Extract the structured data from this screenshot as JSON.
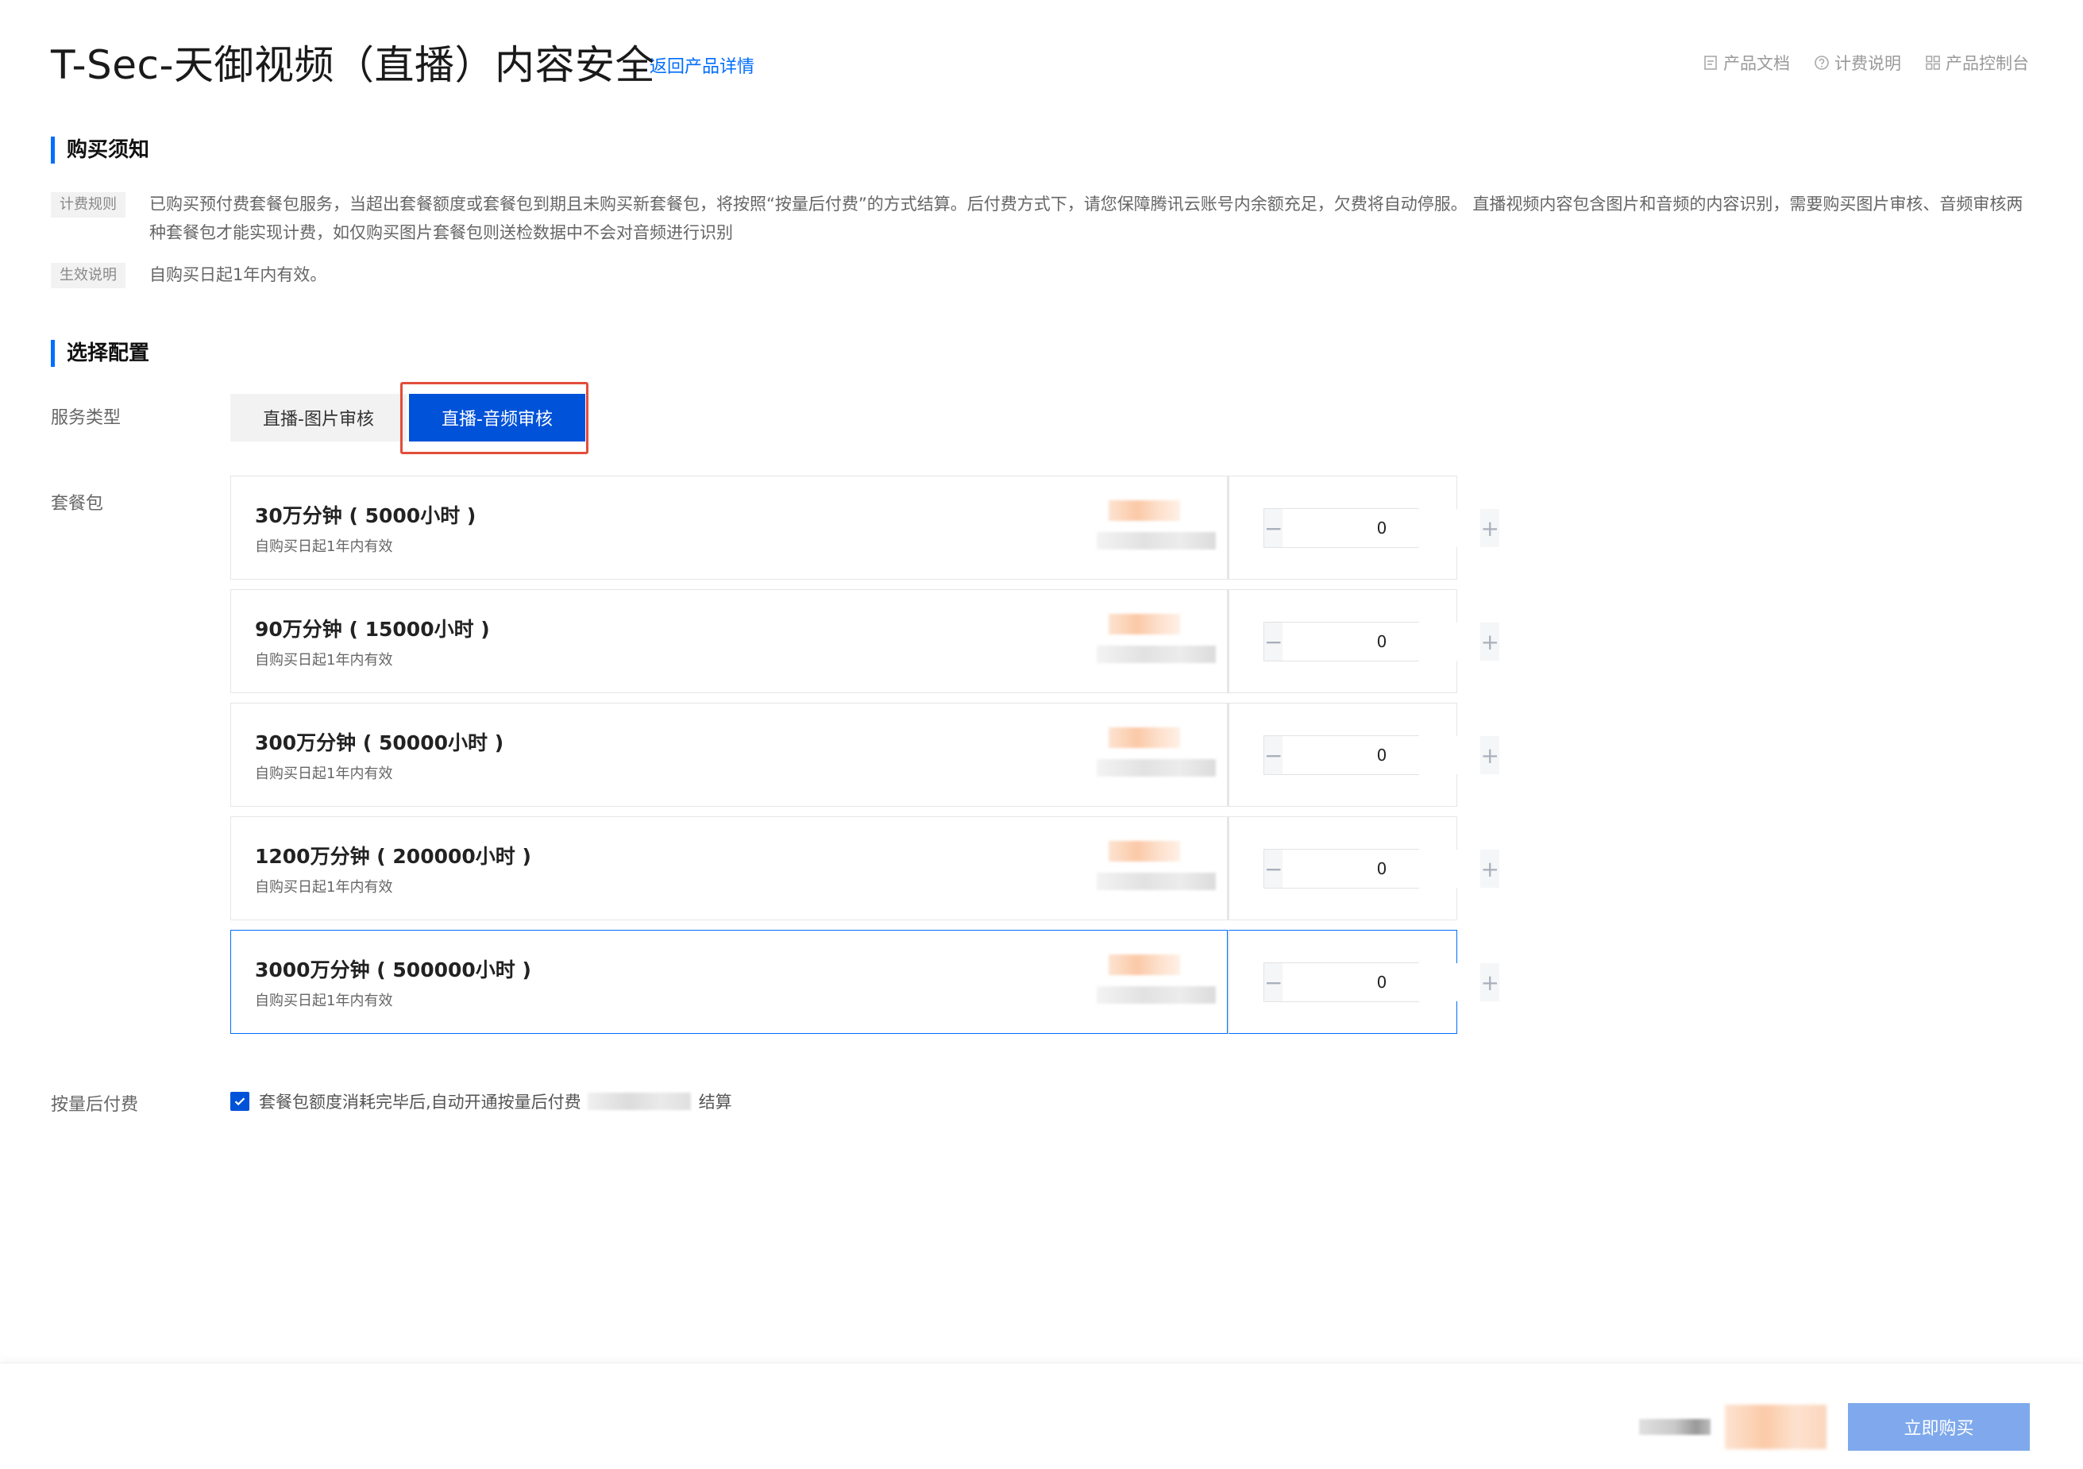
{
  "header": {
    "title": "T-Sec-天御视频（直播）内容安全",
    "back_link": "返回产品详情",
    "links": [
      {
        "label": "产品文档",
        "icon": "document-icon"
      },
      {
        "label": "计费说明",
        "icon": "question-circle-icon"
      },
      {
        "label": "产品控制台",
        "icon": "grid-icon"
      }
    ]
  },
  "notice": {
    "title": "购买须知",
    "rows": [
      {
        "tag": "计费规则",
        "text": "已购买预付费套餐包服务，当超出套餐额度或套餐包到期且未购买新套餐包，将按照“按量后付费”的方式结算。后付费方式下，请您保障腾讯云账号内余额充足，欠费将自动停服。 直播视频内容包含图片和音频的内容识别，需要购买图片审核、音频审核两种套餐包才能实现计费，如仅购买图片套餐包则送检数据中不会对音频进行识别"
      },
      {
        "tag": "生效说明",
        "text": "自购买日起1年内有效。"
      }
    ]
  },
  "config": {
    "title": "选择配置",
    "service_type_label": "服务类型",
    "service_types": [
      "直播-图片审核",
      "直播-音频审核"
    ],
    "selected_service_type": "直播-音频审核",
    "package_label": "套餐包",
    "packages": [
      {
        "name": "30万分钟 ( 5000小时 )",
        "desc": "自购买日起1年内有效",
        "qty": "0"
      },
      {
        "name": "90万分钟 ( 15000小时 )",
        "desc": "自购买日起1年内有效",
        "qty": "0"
      },
      {
        "name": "300万分钟 ( 50000小时 )",
        "desc": "自购买日起1年内有效",
        "qty": "0"
      },
      {
        "name": "1200万分钟 ( 200000小时 )",
        "desc": "自购买日起1年内有效",
        "qty": "0"
      },
      {
        "name": "3000万分钟 ( 500000小时 )",
        "desc": "自购买日起1年内有效",
        "qty": "0"
      }
    ],
    "selected_package_index": 4,
    "postpaid_label": "按量后付费",
    "postpaid_text": "套餐包额度消耗完毕后,自动开通按量后付费",
    "postpaid_suffix": "结算",
    "postpaid_checked": true
  },
  "footer": {
    "buy_label": "立即购买"
  },
  "colors": {
    "accent": "#0052d9",
    "link": "#006eff",
    "highlight": "#e34d3b",
    "buy_button": "#7fa9ec"
  }
}
